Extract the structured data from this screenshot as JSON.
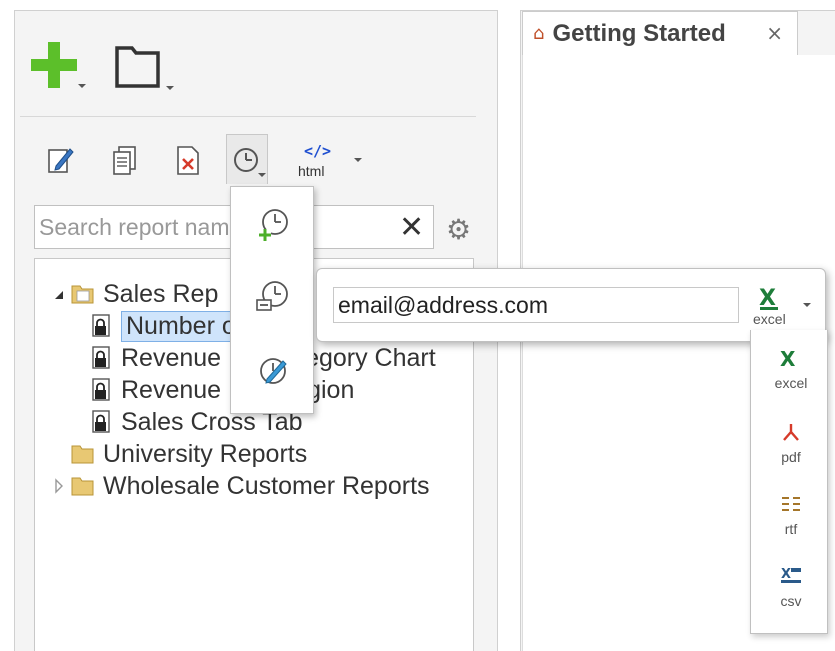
{
  "toolbar": {
    "add_label": "Add",
    "folder_label": "Folder",
    "html_label": "html",
    "html_code": "</>"
  },
  "search": {
    "placeholder": "Search report name"
  },
  "tree": {
    "folders": [
      {
        "label": "Sales Rep",
        "expanded": true
      },
      {
        "label": "University Reports"
      },
      {
        "label": "Wholesale Customer Reports"
      }
    ],
    "reports": [
      {
        "label": "Number of"
      },
      {
        "label": "Revenue",
        "suffix": "egory Chart"
      },
      {
        "label": "Revenue",
        "suffix": "gion"
      },
      {
        "label": "Sales Cross Tab"
      }
    ]
  },
  "tabs": [
    {
      "label": "Getting Started",
      "close": "×"
    }
  ],
  "email": {
    "value": "email@address.com"
  },
  "formats": {
    "selected": "excel",
    "items": [
      "excel",
      "pdf",
      "rtf",
      "csv"
    ]
  },
  "colors": {
    "add_green": "#5cbf2a",
    "selection": "#cfe4fb",
    "html_blue": "#1f4fd0",
    "pdf_red": "#d63a2a",
    "excel_green": "#1e7d3a",
    "rtf_brown": "#a5762a"
  },
  "icons": {
    "clear": "✕",
    "gear": "⚙",
    "home": "⌂"
  }
}
